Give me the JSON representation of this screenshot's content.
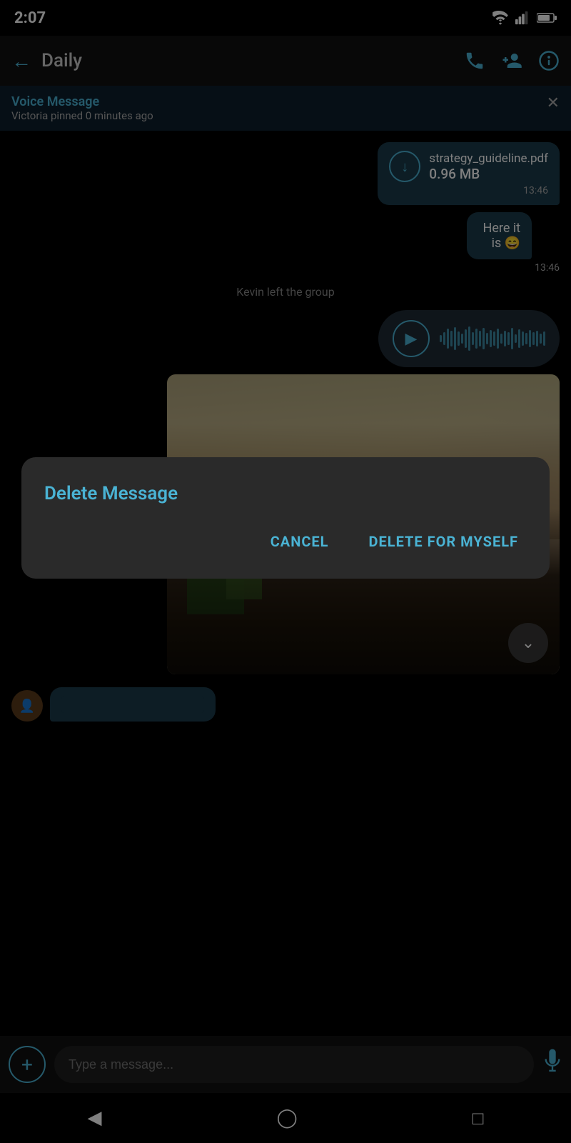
{
  "statusBar": {
    "time": "2:07",
    "wifiIcon": "wifi-icon",
    "signalIcon": "signal-icon",
    "batteryIcon": "battery-icon"
  },
  "topNav": {
    "backLabel": "←",
    "title": "Daily",
    "callIcon": "call-icon",
    "addPersonIcon": "add-person-icon",
    "infoIcon": "info-icon"
  },
  "pinnedBanner": {
    "title": "Voice Message",
    "subtitle": "Victoria pinned 0 minutes ago",
    "closeIcon": "close-icon"
  },
  "messages": [
    {
      "type": "file",
      "filename": "strategy_guideline.pdf",
      "filesize": "0.96 MB",
      "time": "13:46"
    },
    {
      "type": "text",
      "text": "Here it is 😄",
      "time": "13:46"
    },
    {
      "type": "system",
      "text": "Kevin left the group"
    },
    {
      "type": "voice"
    }
  ],
  "imageMessage": {
    "description": "Waterfall landscape photo"
  },
  "inputBar": {
    "placeholder": "Type a message...",
    "addIcon": "add-icon",
    "micIcon": "mic-icon"
  },
  "dialog": {
    "title": "Delete Message",
    "cancelLabel": "CANCEL",
    "deleteLabel": "DELETE FOR MYSELF"
  },
  "sysNav": {
    "backIcon": "back-icon",
    "homeIcon": "home-icon",
    "recentIcon": "recent-icon"
  },
  "scrollDownIcon": "chevron-down-icon"
}
